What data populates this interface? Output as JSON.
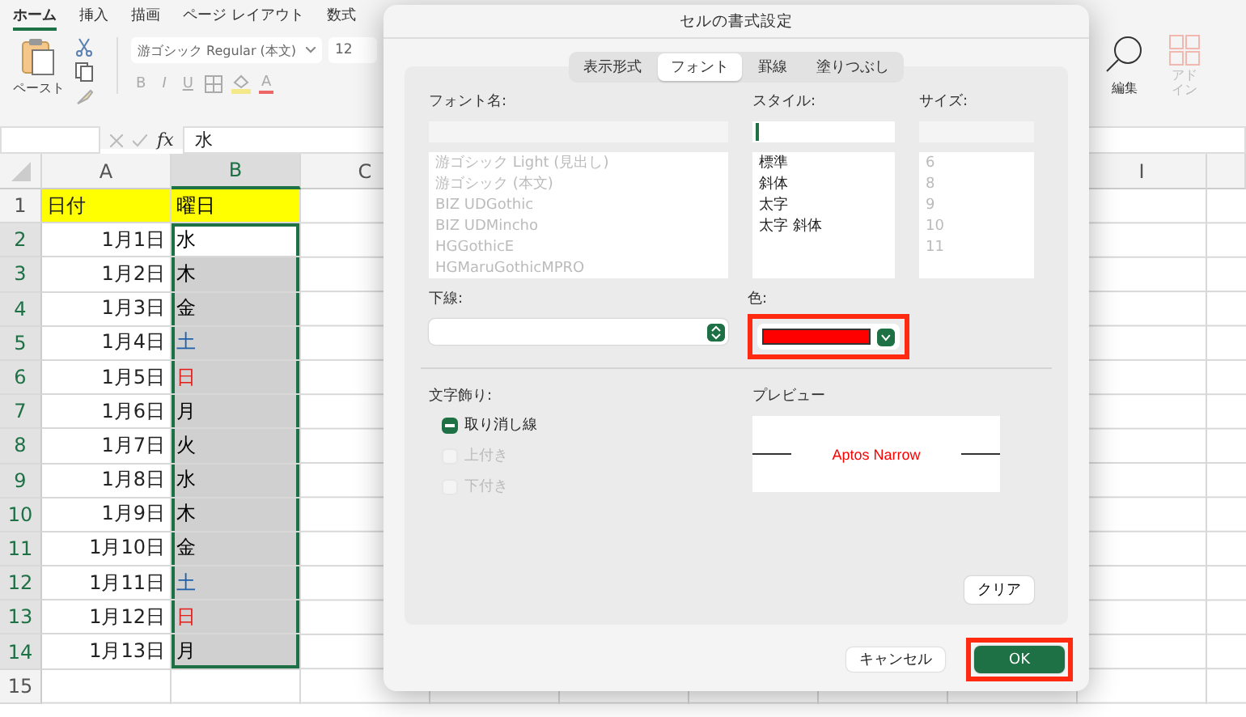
{
  "ribbon": {
    "tabs": [
      {
        "label": "ホーム",
        "selected": true
      },
      {
        "label": "挿入",
        "selected": false
      },
      {
        "label": "描画",
        "selected": false
      },
      {
        "label": "ページ レイアウト",
        "selected": false
      },
      {
        "label": "数式",
        "selected": false
      }
    ],
    "paste_label": "ペースト",
    "font_field": "游ゴシック Regular (本文)",
    "size_field": "12",
    "format_buttons": [
      "B",
      "I",
      "U"
    ],
    "font_color_label": "A",
    "edit_label": "編集",
    "addin": {
      "label": "アドイン",
      "disabled": true
    }
  },
  "formula_bar": {
    "function_label": "fx",
    "value": "水"
  },
  "sheet": {
    "columns": [
      {
        "label": "A",
        "selected": false
      },
      {
        "label": "B",
        "selected": true
      },
      {
        "label": "C",
        "selected": false
      }
    ],
    "far_columns": [
      {
        "label": "I",
        "selected": false
      }
    ],
    "rows": [
      {
        "number": "1",
        "date": "日付",
        "day": "曜日",
        "header": true,
        "selected": false
      },
      {
        "number": "2",
        "date": "1月1日",
        "day": "水",
        "header": false,
        "selected": true,
        "active": true,
        "color": "#000000"
      },
      {
        "number": "3",
        "date": "1月2日",
        "day": "木",
        "header": false,
        "selected": true,
        "active": false,
        "color": "#000000"
      },
      {
        "number": "4",
        "date": "1月3日",
        "day": "金",
        "header": false,
        "selected": true,
        "active": false,
        "color": "#000000"
      },
      {
        "number": "5",
        "date": "1月4日",
        "day": "土",
        "header": false,
        "selected": true,
        "active": false,
        "color": "#1f5fa8"
      },
      {
        "number": "6",
        "date": "1月5日",
        "day": "日",
        "header": false,
        "selected": true,
        "active": false,
        "color": "#e0201c"
      },
      {
        "number": "7",
        "date": "1月6日",
        "day": "月",
        "header": false,
        "selected": true,
        "active": false,
        "color": "#000000"
      },
      {
        "number": "8",
        "date": "1月7日",
        "day": "火",
        "header": false,
        "selected": true,
        "active": false,
        "color": "#000000"
      },
      {
        "number": "9",
        "date": "1月8日",
        "day": "水",
        "header": false,
        "selected": true,
        "active": false,
        "color": "#000000"
      },
      {
        "number": "10",
        "date": "1月9日",
        "day": "木",
        "header": false,
        "selected": true,
        "active": false,
        "color": "#000000"
      },
      {
        "number": "11",
        "date": "1月10日",
        "day": "金",
        "header": false,
        "selected": true,
        "active": false,
        "color": "#000000"
      },
      {
        "number": "12",
        "date": "1月11日",
        "day": "土",
        "header": false,
        "selected": true,
        "active": false,
        "color": "#1f5fa8"
      },
      {
        "number": "13",
        "date": "1月12日",
        "day": "日",
        "header": false,
        "selected": true,
        "active": false,
        "color": "#e0201c"
      },
      {
        "number": "14",
        "date": "1月13日",
        "day": "月",
        "header": false,
        "selected": true,
        "active": false,
        "color": "#000000"
      },
      {
        "number": "15",
        "selected": false
      }
    ]
  },
  "dialog": {
    "title": "セルの書式設定",
    "tabs": [
      {
        "label": "表示形式",
        "selected": false
      },
      {
        "label": "フォント",
        "selected": true
      },
      {
        "label": "罫線",
        "selected": false
      },
      {
        "label": "塗りつぶし",
        "selected": false
      }
    ],
    "font_name": {
      "label": "フォント名:",
      "items": [
        {
          "label": "游ゴシック Light (見出し)",
          "disabled": true
        },
        {
          "label": "游ゴシック (本文)",
          "disabled": true
        },
        {
          "label": "BIZ UDGothic",
          "disabled": true
        },
        {
          "label": "BIZ UDMincho",
          "disabled": true
        },
        {
          "label": "HGGothicE",
          "disabled": true
        },
        {
          "label": "HGMaruGothicMPRO",
          "disabled": true
        }
      ]
    },
    "style": {
      "label": "スタイル:",
      "items": [
        {
          "label": "標準",
          "disabled": false
        },
        {
          "label": "斜体",
          "disabled": false
        },
        {
          "label": "太字",
          "disabled": false
        },
        {
          "label": "太字 斜体",
          "disabled": false
        }
      ]
    },
    "size": {
      "label": "サイズ:",
      "items": [
        {
          "label": "6",
          "disabled": true
        },
        {
          "label": "8",
          "disabled": true
        },
        {
          "label": "9",
          "disabled": true
        },
        {
          "label": "10",
          "disabled": true
        },
        {
          "label": "11",
          "disabled": true
        }
      ]
    },
    "underline": {
      "label": "下線:"
    },
    "color": {
      "label": "色:",
      "color": "#ff0000",
      "highlighted": true
    },
    "effects": {
      "label": "文字飾り:",
      "items": [
        {
          "label": "取り消し線",
          "checked": true,
          "disabled": false
        },
        {
          "label": "上付き",
          "checked": false,
          "disabled": true
        },
        {
          "label": "下付き",
          "checked": false,
          "disabled": true
        }
      ]
    },
    "preview": {
      "label": "プレビュー",
      "text": "Aptos Narrow",
      "color": "#ff0000"
    },
    "clear_button": "クリア",
    "buttons": [
      {
        "label": "キャンセル",
        "default": false,
        "highlighted": false
      },
      {
        "label": "OK",
        "default": true,
        "highlighted": true
      }
    ]
  }
}
